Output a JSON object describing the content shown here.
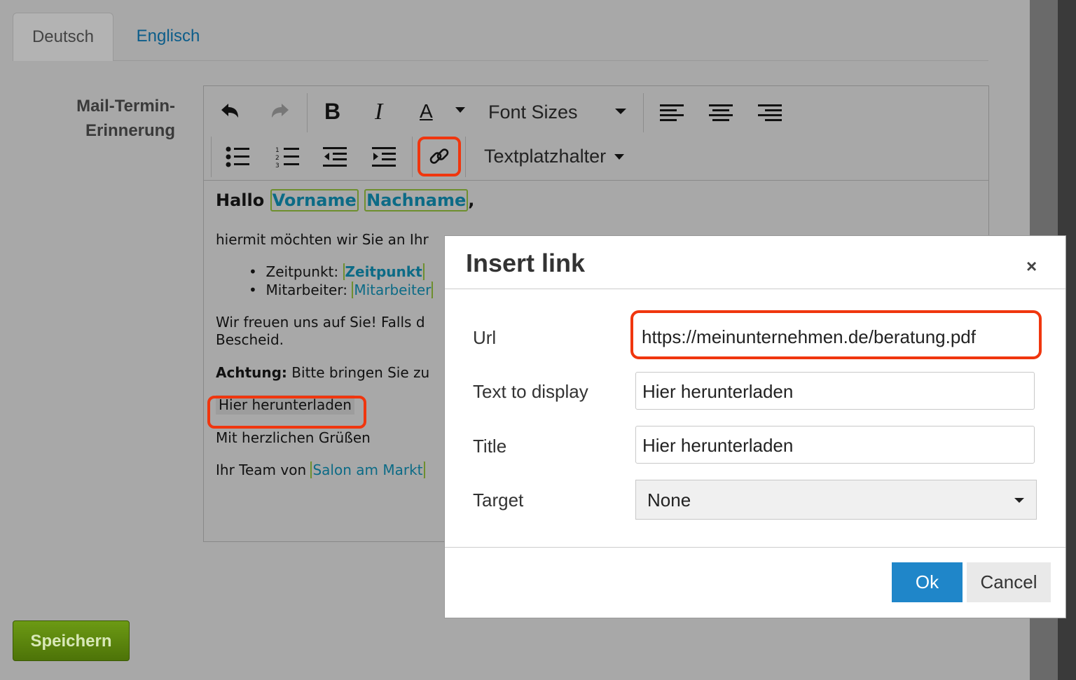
{
  "tabs": [
    {
      "label": "Deutsch"
    },
    {
      "label": "Englisch"
    }
  ],
  "field_label": {
    "line1": "Mail-Termin-",
    "line2": "Erinnerung"
  },
  "toolbar": {
    "font_sizes_label": "Font Sizes",
    "placeholder_menu_label": "Textplatzhalter",
    "bold_label": "B",
    "italic_label": "I",
    "text_color_label": "A"
  },
  "content": {
    "greeting": "Hallo",
    "first_name": "Vorname",
    "last_name": "Nachname",
    "comma": ",",
    "intro": "hiermit möchten wir Sie an Ihr",
    "bullet1_label": "Zeitpunkt:",
    "bullet1_value": "Zeitpunkt",
    "bullet2_label": "Mitarbeiter:",
    "bullet2_value": "Mitarbeiter",
    "para_line1": "Wir freuen uns auf Sie! Falls d",
    "para_line2": "Bescheid.",
    "warning_label": "Achtung:",
    "warning_text": "Bitte bringen Sie zu",
    "download_link": "Hier herunterladen",
    "closing": "Mit herzlichen Grüßen",
    "team_prefix": "Ihr Team von",
    "team_name": "Salon am Markt"
  },
  "dialog": {
    "title": "Insert link",
    "close": "×",
    "url_label": "Url",
    "url_value": "https://meinunternehmen.de/beratung.pdf",
    "text_label": "Text to display",
    "text_value": "Hier herunterladen",
    "title_label": "Title",
    "title_value": "Hier herunterladen",
    "target_label": "Target",
    "target_value": "None",
    "ok_label": "Ok",
    "cancel_label": "Cancel"
  },
  "save_button": "Speichern",
  "colors": {
    "highlight": "#f0360e",
    "primary": "#1f86c9",
    "save": "#5a850e",
    "placeholder_border": "#6e8f2e",
    "link": "#0c5d8a"
  }
}
